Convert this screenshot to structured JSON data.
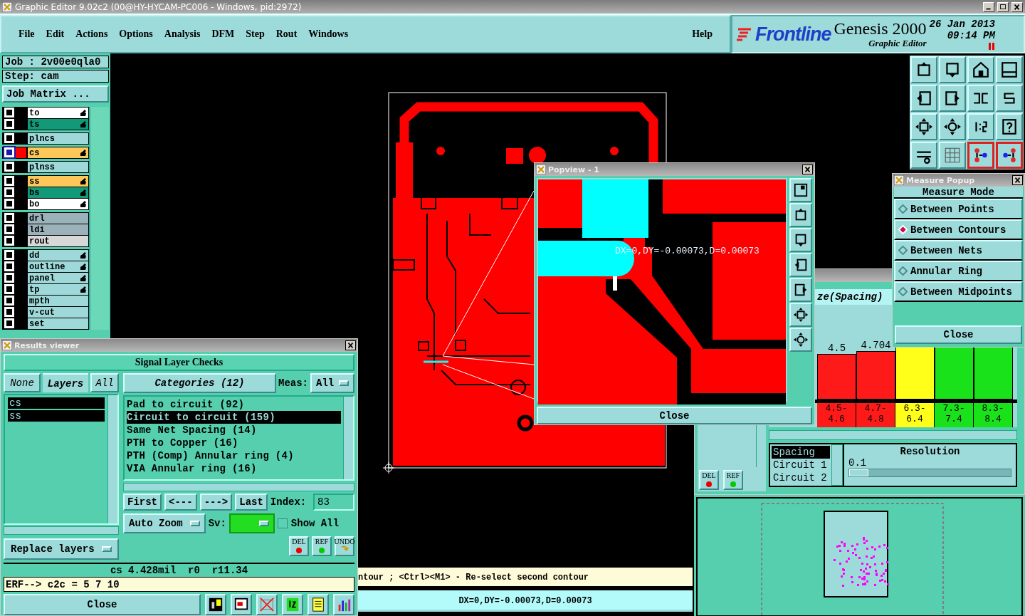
{
  "window": {
    "title": "Graphic Editor 9.02c2 (00@HY-HYCAM-PC006 - Windows, pid:2972)"
  },
  "menu": [
    "File",
    "Edit",
    "Actions",
    "Options",
    "Analysis",
    "DFM",
    "Step",
    "Rout",
    "Windows"
  ],
  "help": "Help",
  "brand": {
    "logo": "Frontline",
    "product": "Genesis 2000",
    "subtitle": "Graphic Editor",
    "date": "26 Jan 2013",
    "time": "09:14 PM"
  },
  "job": {
    "job": "Job : 2v00e0qla0",
    "step": "Step: cam",
    "matrix_button": "Job Matrix ..."
  },
  "layer_groups": [
    {
      "layers": [
        {
          "name": "to",
          "color": "#ffffff",
          "editable": true,
          "selected": false
        },
        {
          "name": "ts",
          "color": "#129a78",
          "editable": true,
          "selected": false
        }
      ]
    },
    {
      "layers": [
        {
          "name": "plncs",
          "color": "#9ed8d8",
          "editable": false,
          "selected": false
        }
      ]
    },
    {
      "layers": [
        {
          "name": "cs",
          "color": "#fdc75a",
          "editable": true,
          "selected": true
        }
      ]
    },
    {
      "layers": [
        {
          "name": "plnss",
          "color": "#9ed8d8",
          "editable": false,
          "selected": false
        }
      ]
    },
    {
      "layers": [
        {
          "name": "ss",
          "color": "#fdc75a",
          "editable": true,
          "selected": false
        },
        {
          "name": "bs",
          "color": "#129a78",
          "editable": true,
          "selected": false
        },
        {
          "name": "bo",
          "color": "#ffffff",
          "editable": true,
          "selected": false
        }
      ]
    },
    {
      "layers": [
        {
          "name": "drl",
          "color": "#9cb2ba",
          "editable": false,
          "selected": false
        },
        {
          "name": "ldi",
          "color": "#9cb2ba",
          "editable": false,
          "selected": false
        },
        {
          "name": "rout",
          "color": "#d8d8d8",
          "editable": false,
          "selected": false
        }
      ]
    },
    {
      "layers": [
        {
          "name": "dd",
          "color": "#9ed8d8",
          "editable": true,
          "selected": false
        },
        {
          "name": "outline",
          "color": "#9ed8d8",
          "editable": true,
          "selected": false
        },
        {
          "name": "panel",
          "color": "#9ed8d8",
          "editable": true,
          "selected": false
        },
        {
          "name": "tp",
          "color": "#9ed8d8",
          "editable": true,
          "selected": false
        },
        {
          "name": "mpth",
          "color": "#9ed8d8",
          "editable": false,
          "selected": false
        },
        {
          "name": "v-cut",
          "color": "#9ed8d8",
          "editable": false,
          "selected": false
        },
        {
          "name": "set",
          "color": "#9ed8d8",
          "editable": false,
          "selected": false
        }
      ]
    }
  ],
  "toolbar": [
    {
      "on": false
    },
    {
      "on": false
    },
    {
      "on": false
    },
    {
      "on": false
    },
    {
      "on": false
    },
    {
      "on": false
    },
    {
      "on": false
    },
    {
      "on": false
    },
    {
      "on": false
    },
    {
      "on": false
    },
    {
      "on": false
    },
    {
      "on": false
    },
    {
      "on": false
    },
    {
      "on": false
    },
    {
      "on": true
    },
    {
      "on": true
    }
  ],
  "popview": {
    "title": "Popview - 1",
    "measurement": "DX=0,DY=-0.00073,D=0.00073",
    "close": "Close"
  },
  "measure_popup": {
    "title": "Measure Popup",
    "heading": "Measure Mode",
    "modes": [
      {
        "label": "Between Points",
        "selected": false
      },
      {
        "label": "Between Contours",
        "selected": true
      },
      {
        "label": "Between Nets",
        "selected": false
      },
      {
        "label": "Annular Ring",
        "selected": false
      },
      {
        "label": "Between Midpoints",
        "selected": false
      }
    ],
    "close": "Close"
  },
  "histogram": {
    "header": "ze(Spacing)",
    "bars": [
      {
        "value_label": "4.5",
        "range_from": "4.5-",
        "range_to": "4.6",
        "color": "#ff1a1a"
      },
      {
        "value_label": "4.704",
        "range_from": "4.7-",
        "range_to": "4.8",
        "color": "#ff1a1a"
      },
      {
        "range_from": "6.3-",
        "range_to": "6.4",
        "color": "#ffff1a"
      },
      {
        "range_from": "7.3-",
        "range_to": "7.4",
        "color": "#1ae21a"
      },
      {
        "range_from": "8.3-",
        "range_to": "8.4",
        "color": "#1ae21a"
      }
    ],
    "fields": [
      {
        "label": "Spacing",
        "selected": true
      },
      {
        "label": "Circuit 1",
        "selected": false
      },
      {
        "label": "Circuit 2",
        "selected": false
      }
    ],
    "resolution_label": "Resolution",
    "resolution_value": "0.1",
    "resolution": {
      "level": 0.12
    },
    "del": "DEL",
    "ref": "REF"
  },
  "results": {
    "title": "Results viewer",
    "heading": "Signal Layer Checks",
    "none": "None",
    "layers_tab": "Layers",
    "all": "All",
    "layers": [
      {
        "name": "cs",
        "selected": true
      },
      {
        "name": "ss",
        "selected": true
      }
    ],
    "categories_button": "Categories (12)",
    "meas_label": "Meas:",
    "meas_value": "All",
    "categories": [
      {
        "label": "Pad to circuit (92)",
        "selected": false
      },
      {
        "label": "Circuit to circuit (159)",
        "selected": true
      },
      {
        "label": "Same Net Spacing (14)",
        "selected": false
      },
      {
        "label": "PTH to Copper (16)",
        "selected": false
      },
      {
        "label": "PTH (Comp) Annular ring (4)",
        "selected": false
      },
      {
        "label": "VIA Annular ring (16)",
        "selected": false
      }
    ],
    "nav": [
      "First",
      "<---",
      "--->",
      "Last"
    ],
    "index_label": "Index:",
    "index": "83",
    "zoom": "Auto Zoom",
    "sv_label": "Sv:",
    "show_all": {
      "label": "Show All",
      "checked": false
    },
    "del": "DEL",
    "ref": "REF",
    "undo": "UNDO",
    "replace": "Replace layers",
    "status": "cs 4.428mil  r0  r11.34",
    "erf": "ERF--> c2c = 5 7 10",
    "close": "Close"
  },
  "prompt": "ntour ; <Ctrl><M1> - Re-select second contour",
  "measure_line": "DX=0,DY=-0.00073,D=0.00073"
}
